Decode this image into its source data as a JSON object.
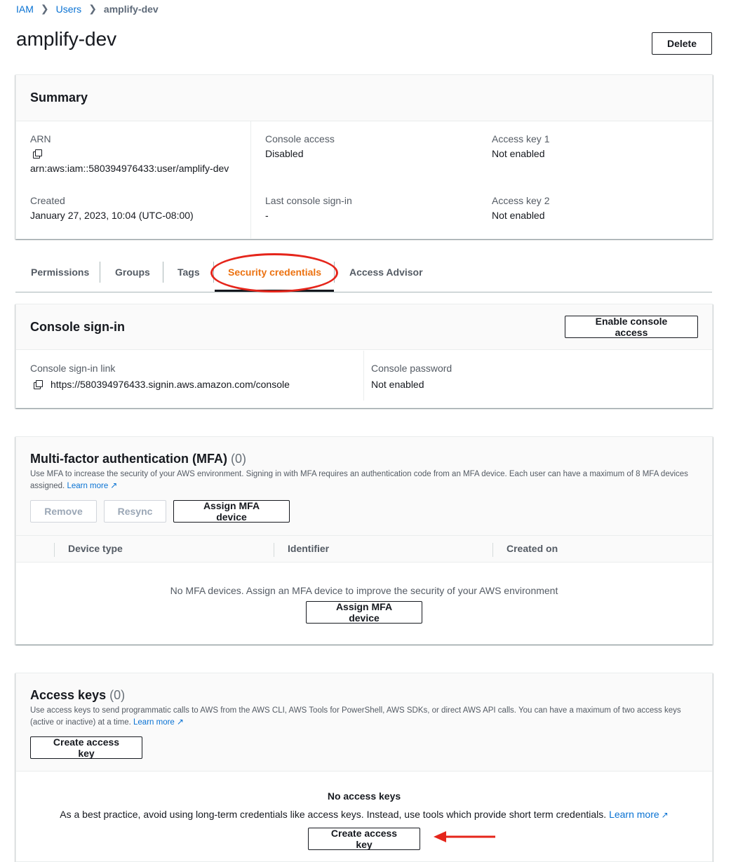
{
  "breadcrumb": {
    "items": [
      "IAM",
      "Users"
    ],
    "current": "amplify-dev"
  },
  "page": {
    "title": "amplify-dev",
    "delete_label": "Delete"
  },
  "summary": {
    "title": "Summary",
    "arn_label": "ARN",
    "arn_value": "arn:aws:iam::580394976433:user/amplify-dev",
    "created_label": "Created",
    "created_value": "January 27, 2023, 10:04 (UTC-08:00)",
    "console_access_label": "Console access",
    "console_access_value": "Disabled",
    "last_signin_label": "Last console sign-in",
    "last_signin_value": "-",
    "key1_label": "Access key 1",
    "key1_value": "Not enabled",
    "key2_label": "Access key 2",
    "key2_value": "Not enabled"
  },
  "tabs": [
    "Permissions",
    "Groups",
    "Tags",
    "Security credentials",
    "Access Advisor"
  ],
  "console_signin": {
    "title": "Console sign-in",
    "enable_label": "Enable console access",
    "link_label": "Console sign-in link",
    "link_value": "https://580394976433.signin.aws.amazon.com/console",
    "password_label": "Console password",
    "password_value": "Not enabled"
  },
  "mfa": {
    "title": "Multi-factor authentication (MFA)",
    "count": "(0)",
    "description": "Use MFA to increase the security of your AWS environment. Signing in with MFA requires an authentication code from an MFA device. Each user can have a maximum of 8 MFA devices assigned.",
    "learn_more": "Learn more",
    "remove_label": "Remove",
    "resync_label": "Resync",
    "assign_label": "Assign MFA device",
    "columns": [
      "Device type",
      "Identifier",
      "Created on"
    ],
    "empty_text": "No MFA devices. Assign an MFA device to improve the security of your AWS environment",
    "empty_assign_label": "Assign MFA device"
  },
  "access_keys": {
    "title": "Access keys",
    "count": "(0)",
    "description": "Use access keys to send programmatic calls to AWS from the AWS CLI, AWS Tools for PowerShell, AWS SDKs, or direct AWS API calls. You can have a maximum of two access keys (active or inactive) at a time.",
    "learn_more": "Learn more",
    "create_label": "Create access key",
    "empty_title": "No access keys",
    "empty_text": "As a best practice, avoid using long-term credentials like access keys. Instead, use tools which provide short term credentials.",
    "empty_learn_more": "Learn more",
    "empty_create_label": "Create access key"
  },
  "colors": {
    "accent": "#ec7211",
    "link": "#0972d3",
    "annotation": "#e5251b"
  }
}
